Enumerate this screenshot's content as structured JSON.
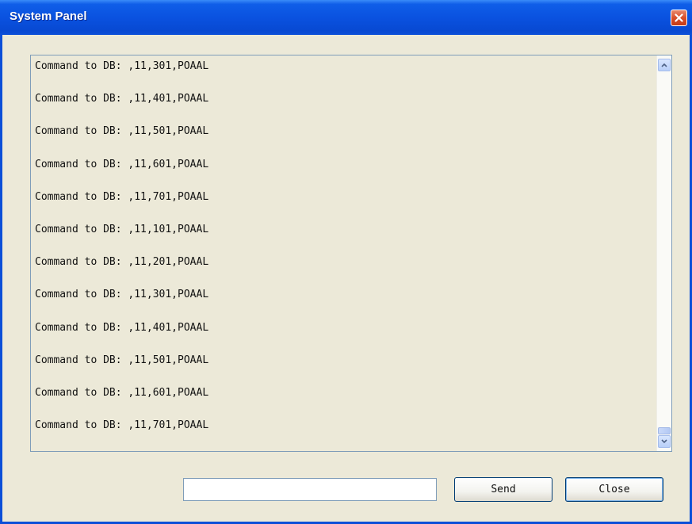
{
  "window": {
    "title": "System Panel",
    "close_icon": "close-x-icon"
  },
  "log": {
    "lines": [
      "Command to DB: ,11,301,POAAL",
      "Command to DB: ,11,401,POAAL",
      "Command to DB: ,11,501,POAAL",
      "Command to DB: ,11,601,POAAL",
      "Command to DB: ,11,701,POAAL",
      "Command to DB: ,11,101,POAAL",
      "Command to DB: ,11,201,POAAL",
      "Command to DB: ,11,301,POAAL",
      "Command to DB: ,11,401,POAAL",
      "Command to DB: ,11,501,POAAL",
      "Command to DB: ,11,601,POAAL",
      "Command to DB: ,11,701,POAAL"
    ]
  },
  "command": {
    "value": "",
    "placeholder": ""
  },
  "buttons": {
    "send_label": "Send",
    "close_label": "Close"
  },
  "colors": {
    "titlebar": "#0a52e0",
    "window_bg": "#ece9d8",
    "close_button": "#d94f2b"
  }
}
